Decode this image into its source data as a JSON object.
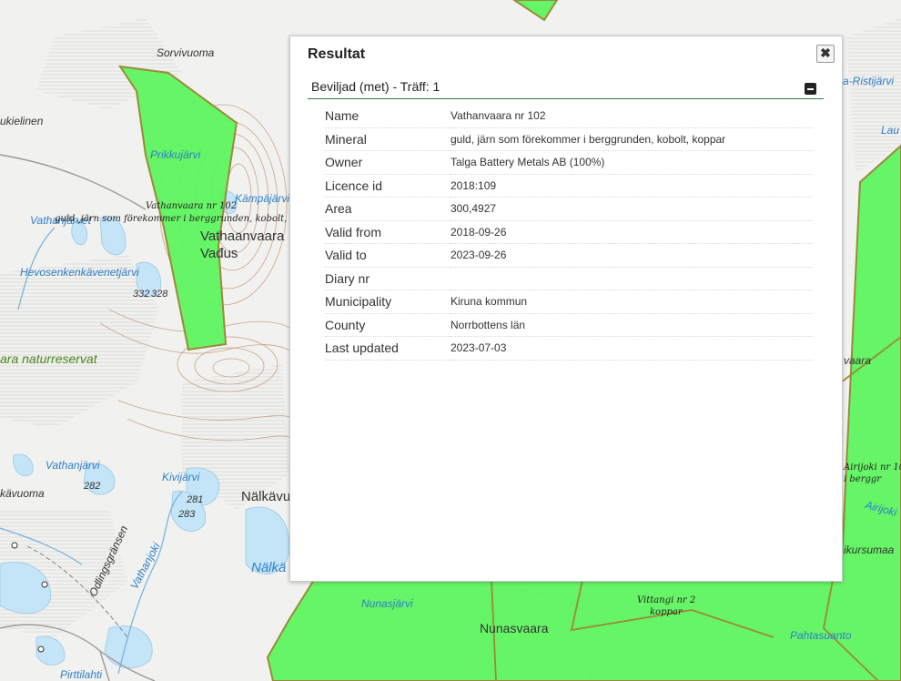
{
  "map": {
    "labels": {
      "sorvivuoma": "Sorvivuoma",
      "ukielinen": "ukielinen",
      "prikkujarvi": "Prikkujärvi",
      "kampajarvi": "Kämpäjärvi",
      "vathanjarvet": "Vathanjärvet",
      "vathaanvaara": "Vathaanvaara",
      "vadus": "Vađus",
      "hevosenkenkavenetjarvi": "Hevosenkenkävenetjärvi",
      "elev_332": "332",
      "elev_328": "328",
      "naturreservat": "ara naturreservat",
      "vathanjarvi": "Vathanjärvi",
      "elev_282": "282",
      "kivijarvi": "Kivijärvi",
      "elev_281": "281",
      "elev_283": "283",
      "kavuoma": "kävuoma",
      "nalkavu": "Nälkävu",
      "nalka_water": "Nälkä",
      "odlingsgransen": "Odlingsgränsen",
      "vathanjoki": "Vathanjoki",
      "nunasjarvi": "Nunasjärvi",
      "nunasvaara": "Nunasvaara",
      "pirttilahti": "Pirttilahti",
      "ristijarvi": "a-Ristijärvi",
      "lau": "Lau",
      "vaara_right": "vaara",
      "airijoki": "Airijoki",
      "sikursumaa": "ikursumaa",
      "pahtasuanto": "Pahtasuanto",
      "poly_vathanvaara_name": "Vathanvaara nr 102",
      "poly_vathanvaara_mineral": "guld, järn som förekommer i berggrunden, kobolt,",
      "poly_vittangi_name": "Vittangi nr 2",
      "poly_vittangi_mineral": "koppar",
      "poly_airijoki_name": "Airijoki nr 10",
      "poly_airijoki_mineral": "i berggr"
    }
  },
  "panel": {
    "title": "Resultat",
    "close_glyph": "✖",
    "section_title": "Beviljad (met) - Träff: 1",
    "rows": [
      {
        "key": "Name",
        "value": "Vathanvaara nr 102"
      },
      {
        "key": "Mineral",
        "value": "guld, järn som förekommer i berggrunden, kobolt, koppar"
      },
      {
        "key": "Owner",
        "value": "Talga Battery Metals AB (100%)"
      },
      {
        "key": "Licence id",
        "value": "2018:109"
      },
      {
        "key": "Area",
        "value": "300,4927"
      },
      {
        "key": "Valid from",
        "value": "2018-09-26"
      },
      {
        "key": "Valid to",
        "value": "2023-09-26"
      },
      {
        "key": "Diary nr",
        "value": ""
      },
      {
        "key": "Municipality",
        "value": "Kiruna kommun"
      },
      {
        "key": "County",
        "value": "Norrbottens län"
      },
      {
        "key": "Last updated",
        "value": "2023-07-03"
      }
    ]
  },
  "colors": {
    "claim_fill": "#5ef45e",
    "claim_stroke": "#9a8a3a",
    "water": "#c4e4f7",
    "contour": "#c9a48a"
  }
}
